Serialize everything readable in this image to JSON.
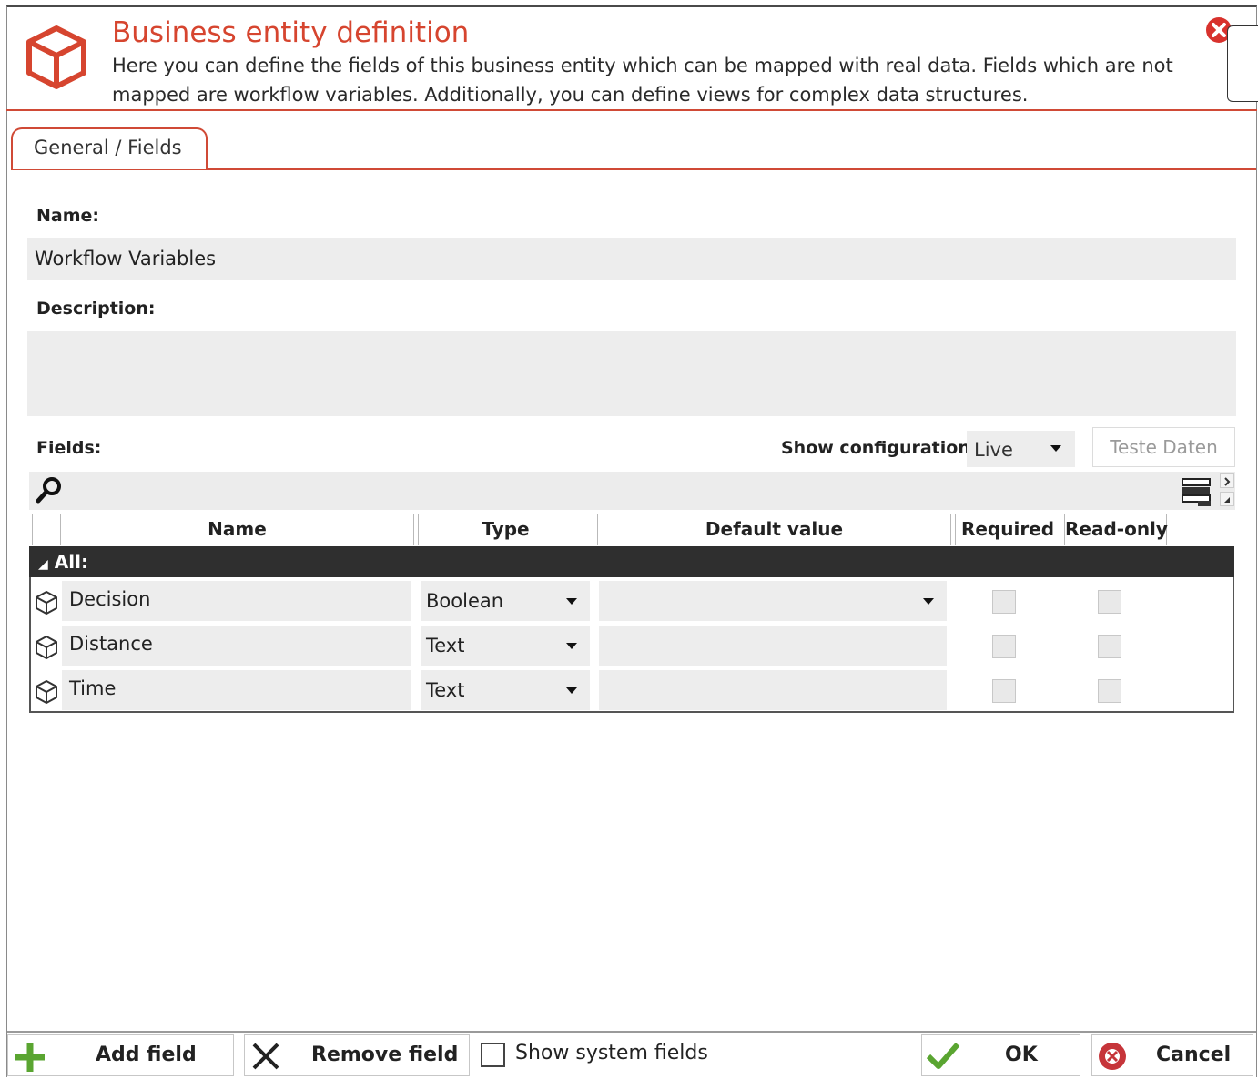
{
  "header": {
    "title": "Business entity definition",
    "subtitle": "Here you can define the fields of this business entity which can be mapped with real data. Fields which are not mapped are workflow variables. Additionally, you can define views for complex data structures."
  },
  "tabs": [
    {
      "label": "General / Fields",
      "active": true
    }
  ],
  "form": {
    "name_label": "Name:",
    "name_value": "Workflow Variables",
    "description_label": "Description:",
    "description_value": "",
    "fields_label": "Fields:",
    "show_config_label": "Show configuration:",
    "show_config_value": "Live",
    "test_button": "Teste Daten"
  },
  "table": {
    "columns": [
      "Name",
      "Type",
      "Default value",
      "Required",
      "Read-only"
    ],
    "group_label": "All:",
    "rows": [
      {
        "name": "Decision",
        "type": "Boolean",
        "default": "",
        "has_default_dropdown": true,
        "required": false,
        "readonly": false
      },
      {
        "name": "Distance",
        "type": "Text",
        "default": "",
        "has_default_dropdown": false,
        "required": false,
        "readonly": false
      },
      {
        "name": "Time",
        "type": "Text",
        "default": "",
        "has_default_dropdown": false,
        "required": false,
        "readonly": false
      }
    ]
  },
  "footer": {
    "add_field": "Add field",
    "remove_field": "Remove field",
    "show_system_fields": "Show system fields",
    "ok": "OK",
    "cancel": "Cancel"
  },
  "colors": {
    "accent": "#d6452f",
    "ok_green": "#5aa531",
    "cancel_red": "#c6353a"
  }
}
